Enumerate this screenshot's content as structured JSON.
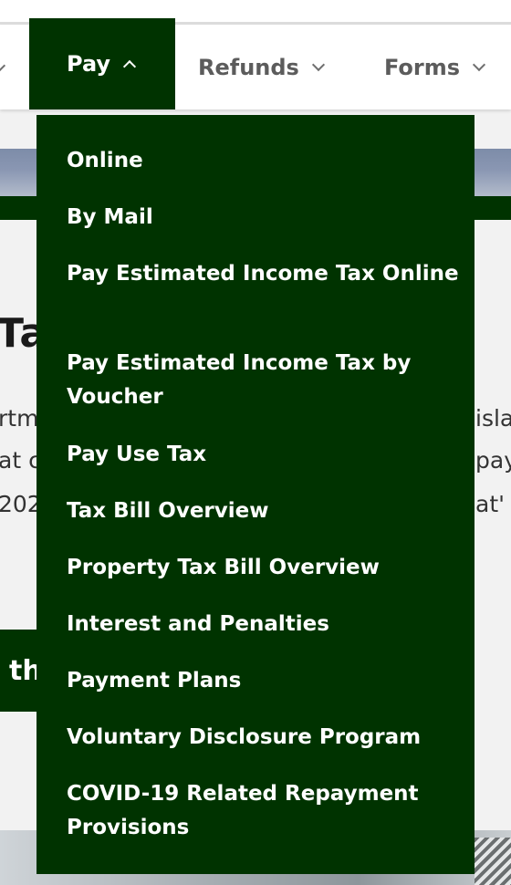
{
  "nav": {
    "items": [
      {
        "label": "Pay",
        "expanded": true
      },
      {
        "label": "Refunds",
        "expanded": false
      },
      {
        "label": "Forms",
        "expanded": false
      }
    ]
  },
  "pay_menu": {
    "items": [
      {
        "label": "Online"
      },
      {
        "label": "By Mail"
      },
      {
        "label": "Pay Estimated Income Tax Online"
      },
      {
        "label": "Pay Estimated Income Tax by Voucher"
      },
      {
        "label": "Pay Use Tax"
      },
      {
        "label": "Tax Bill Overview"
      },
      {
        "label": "Property Tax Bill Overview"
      },
      {
        "label": "Interest and Penalties"
      },
      {
        "label": "Payment Plans"
      },
      {
        "label": "Voluntary Disclosure Program"
      },
      {
        "label": "COVID-19 Related Repayment Provisions"
      }
    ]
  },
  "background": {
    "heading_fragment": "Ta",
    "body_left": [
      "rtm",
      "at c",
      "202"
    ],
    "body_right": [
      "isla",
      "pay",
      "at'"
    ],
    "cta_fragment": "th"
  },
  "colors": {
    "brand_green": "#003300",
    "nav_text": "#5c5c5c"
  }
}
